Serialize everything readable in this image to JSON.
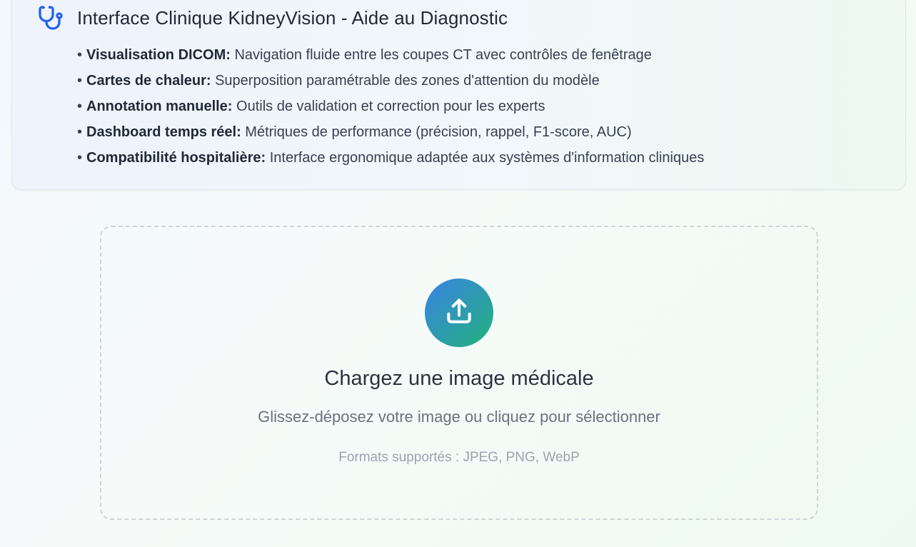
{
  "info_card": {
    "icon": "stethoscope-icon",
    "title": "Interface Clinique KidneyVision - Aide au Diagnostic",
    "features": [
      {
        "bullet": "•",
        "term": "Visualisation DICOM:",
        "description": " Navigation fluide entre les coupes CT avec contrôles de fenêtrage"
      },
      {
        "bullet": "•",
        "term": "Cartes de chaleur:",
        "description": " Superposition paramétrable des zones d'attention du modèle"
      },
      {
        "bullet": "•",
        "term": "Annotation manuelle:",
        "description": " Outils de validation et correction pour les experts"
      },
      {
        "bullet": "•",
        "term": "Dashboard temps réel:",
        "description": " Métriques de performance (précision, rappel, F1-score, AUC)"
      },
      {
        "bullet": "•",
        "term": "Compatibilité hospitalière:",
        "description": " Interface ergonomique adaptée aux systèmes d'information cliniques"
      }
    ]
  },
  "upload": {
    "icon": "upload-icon",
    "title": "Chargez une image médicale",
    "hint": "Glissez-déposez votre image ou cliquez pour sélectionner",
    "formats": "Formats supportés : JPEG, PNG, WebP"
  },
  "colors": {
    "accent_blue": "#2563eb",
    "gradient_start": "#3a82e6",
    "gradient_end": "#22b37a"
  }
}
